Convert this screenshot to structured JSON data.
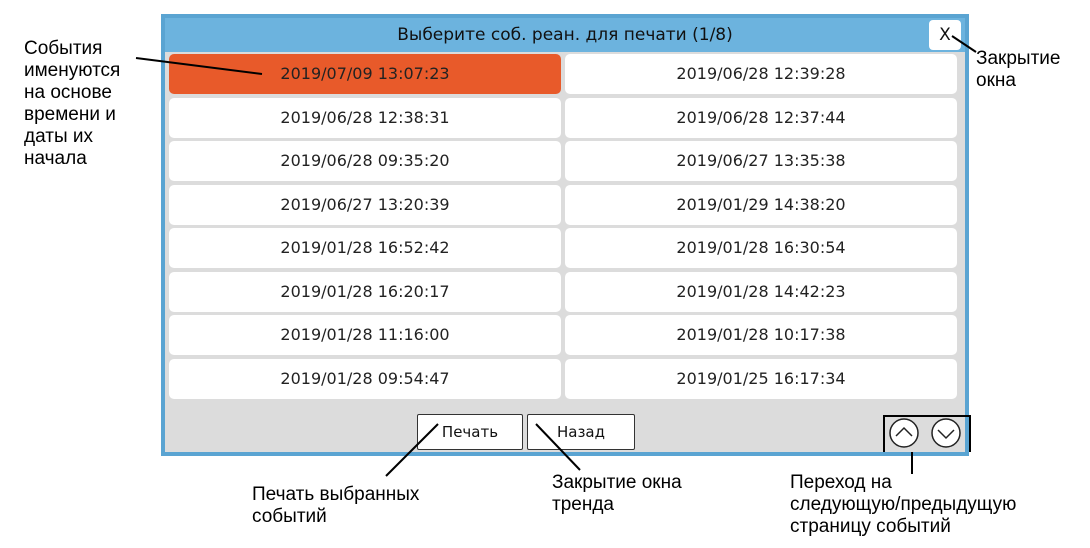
{
  "dialog": {
    "title": "Выберите соб. реан. для печати (1/8)",
    "close_label": "X",
    "events": [
      "2019/07/09 13:07:23",
      "2019/06/28 12:39:28",
      "2019/06/28 12:38:31",
      "2019/06/28 12:37:44",
      "2019/06/28 09:35:20",
      "2019/06/27 13:35:38",
      "2019/06/27 13:20:39",
      "2019/01/29 14:38:20",
      "2019/01/28 16:52:42",
      "2019/01/28 16:30:54",
      "2019/01/28 16:20:17",
      "2019/01/28 14:42:23",
      "2019/01/28 11:16:00",
      "2019/01/28 10:17:38",
      "2019/01/28 09:54:47",
      "2019/01/25 16:17:34"
    ],
    "selected_event": "2019/07/09 13:07:23",
    "print_label": "Печать",
    "back_label": "Назад",
    "nav_up_icon": "chevron-up-circle-icon",
    "nav_down_icon": "chevron-down-circle-icon"
  },
  "annotations": {
    "events_named": "События\nименуются\nна основе\nвремени и\nдаты их\nначала",
    "close_window": "Закрытие\nокна",
    "print_selected": "Печать выбранных\nсобытий",
    "close_trend": "Закрытие окна\nтренда",
    "paging": "Переход на\nследующую/предыдущую\nстраницу событий"
  },
  "colors": {
    "title_bar": "#6cb3de",
    "selected": "#e85a2a",
    "panel": "#dcdcdc"
  }
}
